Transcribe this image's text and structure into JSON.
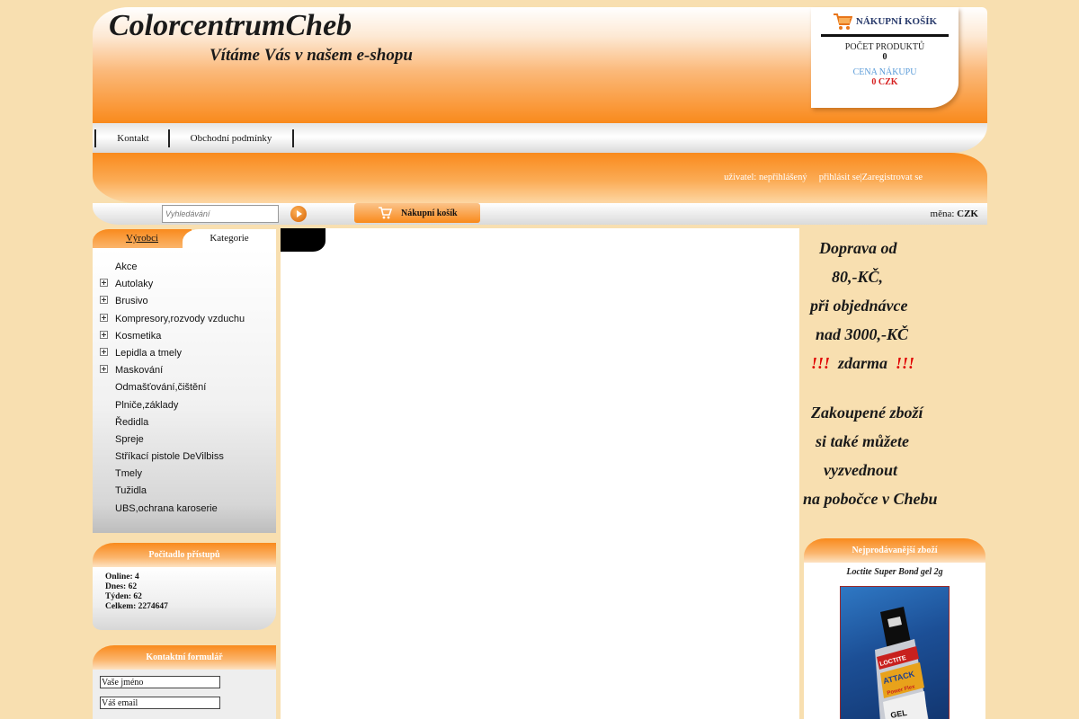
{
  "header": {
    "title": "ColorcentrumCheb",
    "subtitle": "Vítáme Vás v našem e-shopu"
  },
  "cart_box": {
    "heading": "NÁKUPNÍ KOŠÍK",
    "count_label": "POČET PRODUKTŮ",
    "count_value": "0",
    "price_label": "CENA NÁKUPU",
    "price_value": "0 CZK"
  },
  "menu": {
    "items": [
      "Kontakt",
      "Obchodní podmínky"
    ]
  },
  "user": {
    "status": "uživatel: nepřihlášený",
    "login": "přihlásit se",
    "separator": "|",
    "register": "Zaregistrovat se"
  },
  "search": {
    "placeholder": "Vyhledávání",
    "cart_button": "Nákupní košík",
    "currency_label": "měna:",
    "currency_value": "CZK"
  },
  "tabs": {
    "makers": "Výrobci",
    "categories": "Kategorie"
  },
  "categories": [
    {
      "label": "Akce",
      "expandable": false
    },
    {
      "label": "Autolaky",
      "expandable": true
    },
    {
      "label": "Brusivo",
      "expandable": true
    },
    {
      "label": "Kompresory,rozvody vzduchu",
      "expandable": true
    },
    {
      "label": "Kosmetika",
      "expandable": true
    },
    {
      "label": "Lepidla a tmely",
      "expandable": true
    },
    {
      "label": "Maskování",
      "expandable": true
    },
    {
      "label": "Odmašťování,čištění",
      "expandable": false
    },
    {
      "label": "Plniče,základy",
      "expandable": false
    },
    {
      "label": "Ředidla",
      "expandable": false
    },
    {
      "label": "Spreje",
      "expandable": false
    },
    {
      "label": "Stříkací pistole DeVilbiss",
      "expandable": false
    },
    {
      "label": "Tmely",
      "expandable": false
    },
    {
      "label": "Tužidla",
      "expandable": false
    },
    {
      "label": "UBS,ochrana karoserie",
      "expandable": false
    }
  ],
  "counter": {
    "title": "Počitadlo přístupů",
    "online": "Online: 4",
    "today": "Dnes: 62",
    "week": "Týden: 62",
    "total": "Celkem: 2274647"
  },
  "contact_form": {
    "title": "Kontaktní formulář",
    "name_value": "Vaše jméno",
    "email_value": "Váš email"
  },
  "promo": {
    "line1": "Doprava od",
    "line2": "80,-KČ,",
    "line3": "při objednávce",
    "line4": "nad 3000,-KČ",
    "line5_mark": "!!!",
    "line5_text": "zdarma",
    "line6": "Zakoupené zboží",
    "line7": "si také můžete",
    "line8": "vyzvednout",
    "line9": "na pobočce v Chebu"
  },
  "bestsellers": {
    "title": "Nejprodávanější zboží",
    "product_name": "Loctite Super Bond gel 2g",
    "product_image_text": [
      "LOCTITE",
      "ATTACK",
      "Power Flex",
      "GEL"
    ]
  },
  "colors": {
    "page_bg": "#f8dfb0",
    "orange": "#f98a1c",
    "link_blue": "#283a6b",
    "price_red": "#d62020",
    "promo_red": "#e00000"
  }
}
